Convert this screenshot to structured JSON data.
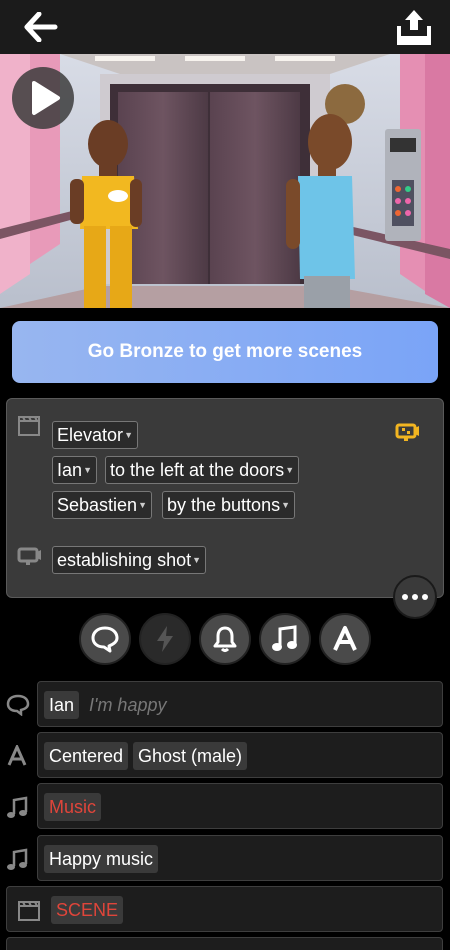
{
  "topbar": {
    "back_icon": "arrow-left-icon",
    "share_icon": "share-upload-icon"
  },
  "preview": {
    "play_icon": "play-icon"
  },
  "upsell": {
    "label": "Go Bronze to get more scenes"
  },
  "scene_settings": {
    "location": "Elevator",
    "actor1": {
      "name": "Ian",
      "position": "to the left at the doors"
    },
    "actor2": {
      "name": "Sebastien",
      "position": "by the buttons"
    },
    "camera": "establishing shot",
    "accent_color": "#f2b521"
  },
  "actions": [
    {
      "icon": "speech-bubble-icon"
    },
    {
      "icon": "lightning-icon"
    },
    {
      "icon": "bell-icon"
    },
    {
      "icon": "music-note-icon"
    },
    {
      "icon": "text-a-icon"
    }
  ],
  "script": [
    {
      "type": "dialogue",
      "speaker": "Ian",
      "placeholder": "I'm happy"
    },
    {
      "type": "title",
      "style": "Centered",
      "font": "Ghost (male)"
    },
    {
      "type": "music",
      "label": "Music",
      "color": "#e0453a"
    },
    {
      "type": "music",
      "label": "Happy music"
    },
    {
      "type": "scene",
      "label": "SCENE",
      "color": "#e0453a"
    }
  ]
}
